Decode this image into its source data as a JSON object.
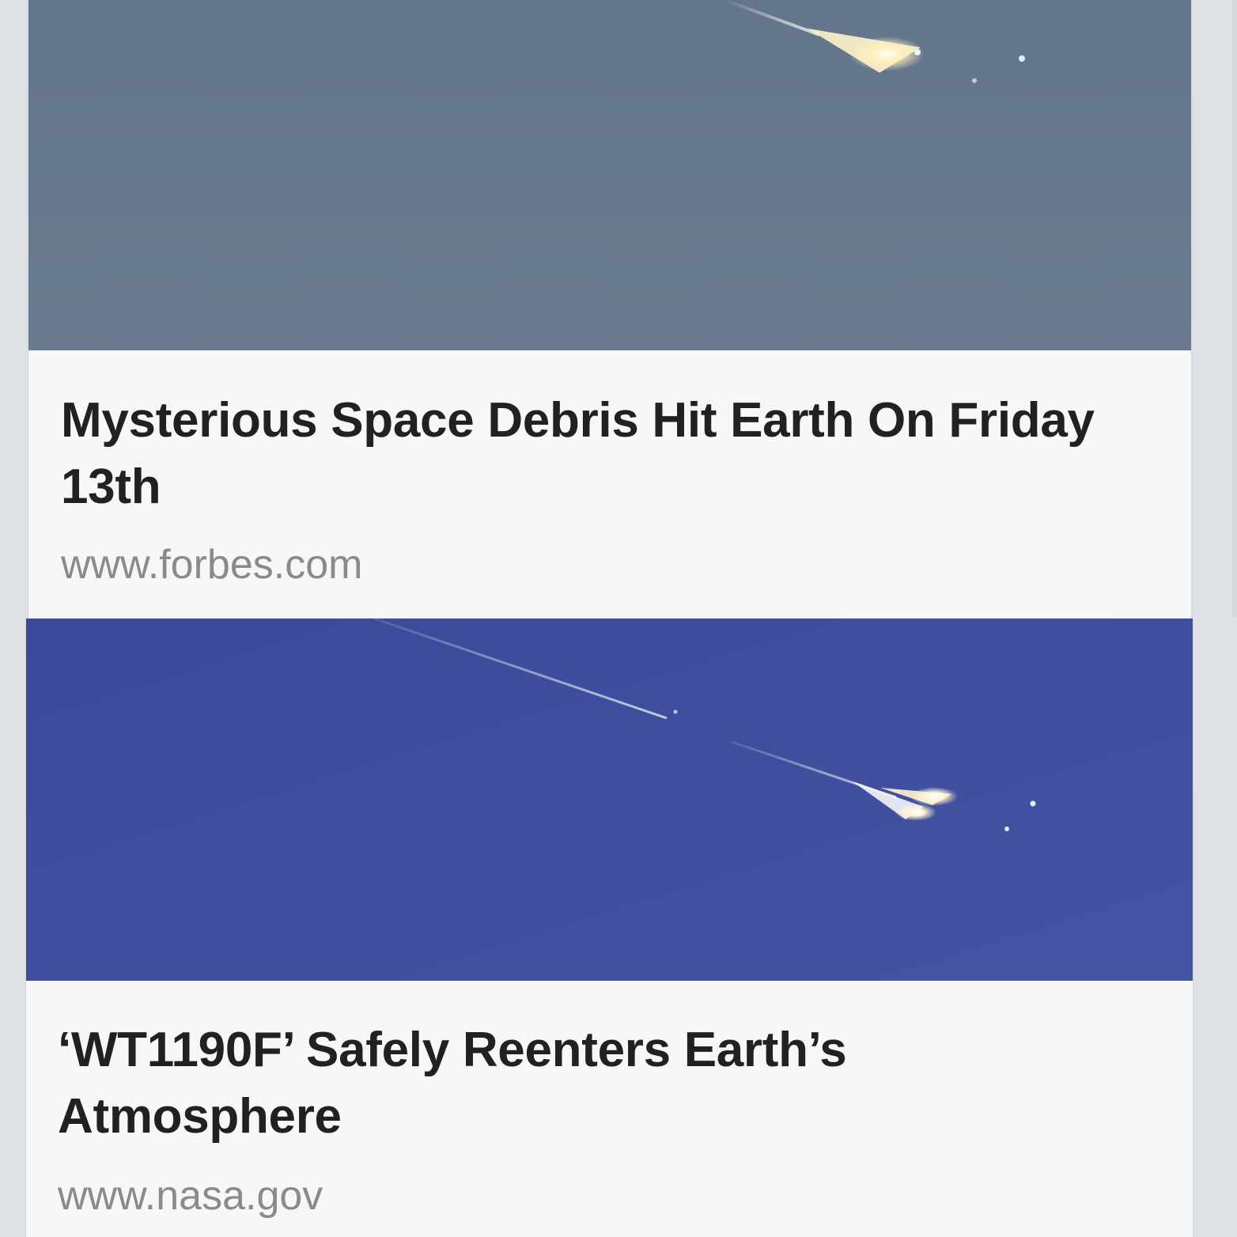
{
  "articles": [
    {
      "image_description": "",
      "title": "Mysterious Space Debris Hit Earth On Friday 13th",
      "source": "www.forbes.com"
    },
    {
      "image_description": "",
      "title": "‘WT1190F’ Safely Reenters Earth’s Atmosphere",
      "source": "www.nasa.gov"
    }
  ],
  "colors": {
    "card_background": "#f7f7f8",
    "title_text": "#212121",
    "source_text": "#8a8a8a",
    "sky_1": "#66778d",
    "sky_2": "#3f4f9d"
  }
}
